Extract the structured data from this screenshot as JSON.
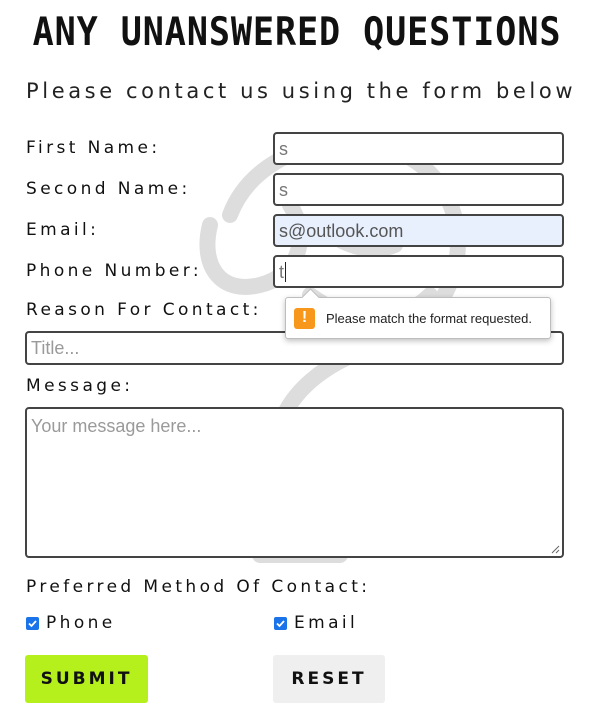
{
  "page": {
    "heading": "ANY UNANSWERED QUESTIONS",
    "subheading": "Please contact us using the form below"
  },
  "form": {
    "first_name": {
      "label": "First Name:",
      "value": "s"
    },
    "second_name": {
      "label": "Second Name:",
      "value": "s"
    },
    "email": {
      "label": "Email:",
      "value": "s@outlook.com"
    },
    "phone": {
      "label": "Phone Number:",
      "value": "t"
    },
    "reason": {
      "label": "Reason For Contact:",
      "placeholder": "Title..."
    },
    "message": {
      "label": "Message:",
      "placeholder": "Your message here..."
    },
    "preferred": {
      "label": "Preferred Method Of Contact:",
      "options": [
        {
          "label": "Phone",
          "checked": true
        },
        {
          "label": "Email",
          "checked": true
        }
      ]
    },
    "validation_tooltip": "Please match the format requested.",
    "submit_label": "SUBMIT",
    "reset_label": "RESET"
  },
  "colors": {
    "submit_bg": "#b5f01d",
    "reset_bg": "#efefef",
    "autofill_bg": "#e8f0fe",
    "checkbox": "#1a73e8",
    "warning": "#f7981c"
  },
  "icons": {
    "warning": "warning-icon",
    "checkmark": "checkmark-icon",
    "watermark": "watermark-logo"
  }
}
